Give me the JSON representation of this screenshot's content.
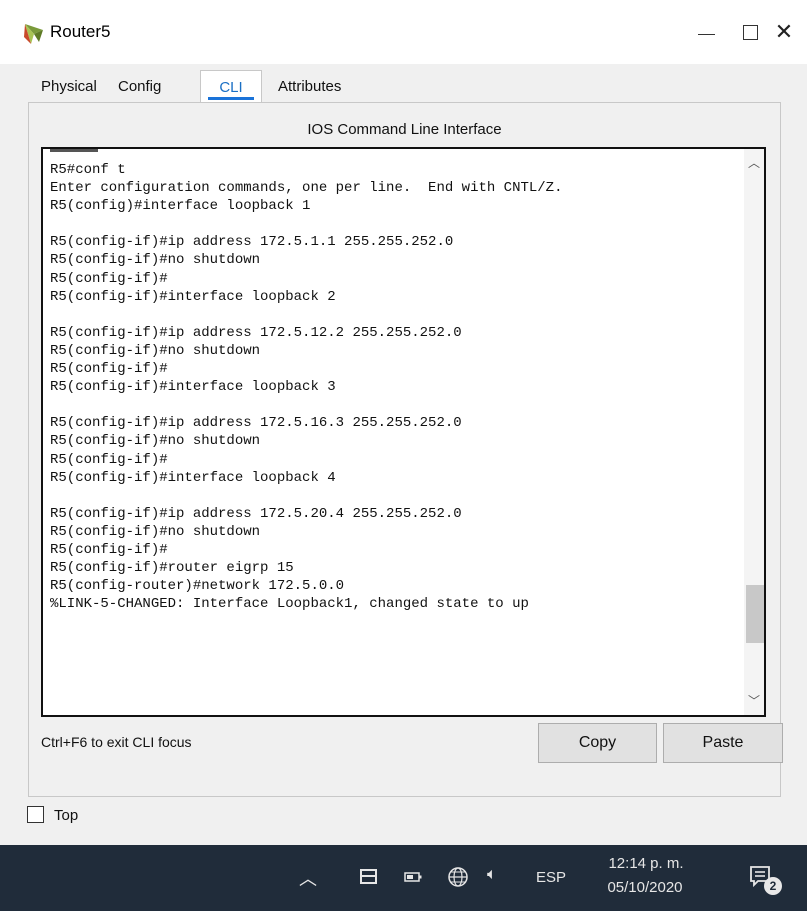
{
  "window": {
    "title": "Router5",
    "icon": "router-icon"
  },
  "tabs": [
    {
      "label": "Physical"
    },
    {
      "label": "Config"
    },
    {
      "label": "CLI"
    },
    {
      "label": "Attributes"
    }
  ],
  "active_tab": "CLI",
  "cli": {
    "header": "IOS Command Line Interface",
    "lines": [
      "R5#conf t",
      "Enter configuration commands, one per line.  End with CNTL/Z.",
      "R5(config)#interface loopback 1",
      "",
      "R5(config-if)#ip address 172.5.1.1 255.255.252.0",
      "R5(config-if)#no shutdown",
      "R5(config-if)#",
      "R5(config-if)#interface loopback 2",
      "",
      "R5(config-if)#ip address 172.5.12.2 255.255.252.0",
      "R5(config-if)#no shutdown",
      "R5(config-if)#",
      "R5(config-if)#interface loopback 3",
      "",
      "R5(config-if)#ip address 172.5.16.3 255.255.252.0",
      "R5(config-if)#no shutdown",
      "R5(config-if)#",
      "R5(config-if)#interface loopback 4",
      "",
      "R5(config-if)#ip address 172.5.20.4 255.255.252.0",
      "R5(config-if)#no shutdown",
      "R5(config-if)#",
      "R5(config-if)#router eigrp 15",
      "R5(config-router)#network 172.5.0.0",
      "%LINK-5-CHANGED: Interface Loopback1, changed state to up"
    ],
    "footer_hint": "Ctrl+F6 to exit CLI focus",
    "copy_label": "Copy",
    "paste_label": "Paste"
  },
  "top_checkbox": {
    "label": "Top",
    "checked": false
  },
  "taskbar": {
    "language": "ESP",
    "time": "12:14 p. m.",
    "date": "05/10/2020",
    "notification_count": "2"
  },
  "colors": {
    "active_tab_underline": "#1a73d9",
    "taskbar_bg": "#202c3a"
  }
}
